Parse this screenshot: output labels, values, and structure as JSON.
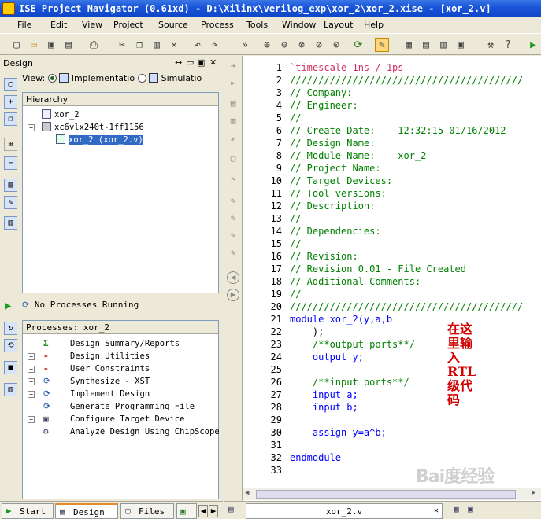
{
  "window": {
    "title": "ISE Project Navigator (0.61xd) - D:\\Xilinx\\verilog_exp\\xor_2\\xor_2.xise - [xor_2.v]"
  },
  "menu": [
    "File",
    "Edit",
    "View",
    "Project",
    "Source",
    "Process",
    "Tools",
    "Window",
    "Layout",
    "Help"
  ],
  "design": {
    "header": "Design",
    "view_label": "View:",
    "impl_label": "Implementatio",
    "sim_label": "Simulatio",
    "hierarchy_header": "Hierarchy",
    "tree": [
      {
        "label": "xor_2"
      },
      {
        "label": "xc6vlx240t-1ff1156"
      },
      {
        "label": "xor_2 (xor_2.v)",
        "selected": true
      }
    ]
  },
  "processes": {
    "status": "No Processes Running",
    "header": "Processes: xor_2",
    "items": [
      "Design Summary/Reports",
      "Design Utilities",
      "User Constraints",
      "Synthesize - XST",
      "Implement Design",
      "Generate Programming File",
      "Configure Target Device",
      "Analyze Design Using ChipScope"
    ]
  },
  "bottom_tabs": [
    "Start",
    "Design",
    "Files"
  ],
  "editor": {
    "file_tab": "xor_2.v",
    "line_numbers": [
      "1",
      "2",
      "3",
      "4",
      "5",
      "6",
      "7",
      "8",
      "9",
      "10",
      "11",
      "12",
      "13",
      "14",
      "15",
      "16",
      "17",
      "18",
      "19",
      "20",
      "21",
      "22",
      "23",
      "24",
      "25",
      "26",
      "27",
      "28",
      "29",
      "30",
      "31",
      "32",
      "33"
    ],
    "lines": [
      "`timescale 1ns / 1ps",
      "/////////////////////////////////////////",
      "// Company:",
      "// Engineer:",
      "//",
      "// Create Date:    12:32:15 01/16/2012",
      "// Design Name:",
      "// Module Name:    xor_2",
      "// Project Name:",
      "// Target Devices:",
      "// Tool versions:",
      "// Description:",
      "//",
      "// Dependencies:",
      "//",
      "// Revision:",
      "// Revision 0.01 - File Created",
      "// Additional Comments:",
      "//",
      "/////////////////////////////////////////",
      "module xor_2(y,a,b",
      "    );",
      "    /**output ports**/",
      "    output y;",
      "",
      "    /**input ports**/",
      "    input a;",
      "    input b;",
      "",
      "    assign y=a^b;",
      "",
      "endmodule",
      ""
    ]
  },
  "annotation": [
    "在这",
    "里输",
    "入RTL",
    "级代",
    "码"
  ],
  "watermark": "Bai度经验"
}
